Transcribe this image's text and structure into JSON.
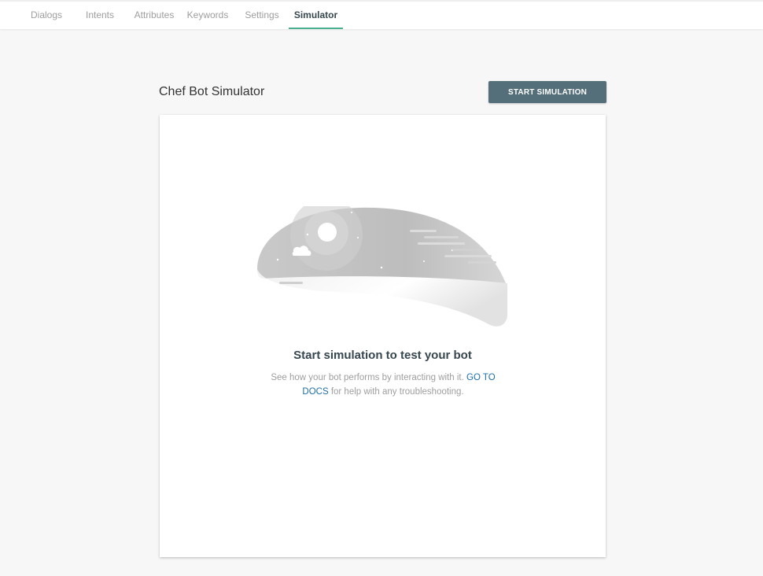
{
  "tabs": [
    {
      "label": "Dialogs"
    },
    {
      "label": "Intents"
    },
    {
      "label": "Attributes"
    },
    {
      "label": "Keywords"
    },
    {
      "label": "Settings"
    },
    {
      "label": "Simulator",
      "active": true
    }
  ],
  "header": {
    "title": "Chef Bot Simulator",
    "start_button_label": "START SIMULATION"
  },
  "empty_state": {
    "title": "Start simulation to test your bot",
    "description_before": "See how your bot performs by interacting with it. ",
    "link_label": "GO TO DOCS",
    "description_after": " for help with any troubleshooting."
  },
  "colors": {
    "accent": "#4caf8f",
    "button": "#546e7a",
    "link": "#1e6fa8"
  },
  "icons": {
    "illustration": "night-sky-illustration"
  }
}
